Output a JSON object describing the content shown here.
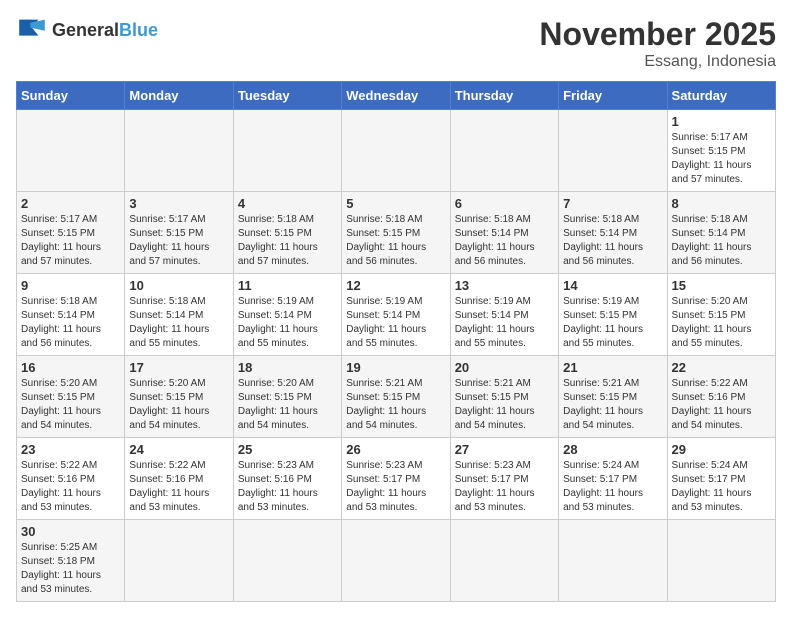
{
  "header": {
    "logo_general": "General",
    "logo_blue": "Blue",
    "month_year": "November 2025",
    "location": "Essang, Indonesia"
  },
  "weekdays": [
    "Sunday",
    "Monday",
    "Tuesday",
    "Wednesday",
    "Thursday",
    "Friday",
    "Saturday"
  ],
  "weeks": [
    [
      {
        "day": "",
        "info": ""
      },
      {
        "day": "",
        "info": ""
      },
      {
        "day": "",
        "info": ""
      },
      {
        "day": "",
        "info": ""
      },
      {
        "day": "",
        "info": ""
      },
      {
        "day": "",
        "info": ""
      },
      {
        "day": "1",
        "info": "Sunrise: 5:17 AM\nSunset: 5:15 PM\nDaylight: 11 hours\nand 57 minutes."
      }
    ],
    [
      {
        "day": "2",
        "info": "Sunrise: 5:17 AM\nSunset: 5:15 PM\nDaylight: 11 hours\nand 57 minutes."
      },
      {
        "day": "3",
        "info": "Sunrise: 5:17 AM\nSunset: 5:15 PM\nDaylight: 11 hours\nand 57 minutes."
      },
      {
        "day": "4",
        "info": "Sunrise: 5:18 AM\nSunset: 5:15 PM\nDaylight: 11 hours\nand 57 minutes."
      },
      {
        "day": "5",
        "info": "Sunrise: 5:18 AM\nSunset: 5:15 PM\nDaylight: 11 hours\nand 56 minutes."
      },
      {
        "day": "6",
        "info": "Sunrise: 5:18 AM\nSunset: 5:14 PM\nDaylight: 11 hours\nand 56 minutes."
      },
      {
        "day": "7",
        "info": "Sunrise: 5:18 AM\nSunset: 5:14 PM\nDaylight: 11 hours\nand 56 minutes."
      },
      {
        "day": "8",
        "info": "Sunrise: 5:18 AM\nSunset: 5:14 PM\nDaylight: 11 hours\nand 56 minutes."
      }
    ],
    [
      {
        "day": "9",
        "info": "Sunrise: 5:18 AM\nSunset: 5:14 PM\nDaylight: 11 hours\nand 56 minutes."
      },
      {
        "day": "10",
        "info": "Sunrise: 5:18 AM\nSunset: 5:14 PM\nDaylight: 11 hours\nand 55 minutes."
      },
      {
        "day": "11",
        "info": "Sunrise: 5:19 AM\nSunset: 5:14 PM\nDaylight: 11 hours\nand 55 minutes."
      },
      {
        "day": "12",
        "info": "Sunrise: 5:19 AM\nSunset: 5:14 PM\nDaylight: 11 hours\nand 55 minutes."
      },
      {
        "day": "13",
        "info": "Sunrise: 5:19 AM\nSunset: 5:14 PM\nDaylight: 11 hours\nand 55 minutes."
      },
      {
        "day": "14",
        "info": "Sunrise: 5:19 AM\nSunset: 5:15 PM\nDaylight: 11 hours\nand 55 minutes."
      },
      {
        "day": "15",
        "info": "Sunrise: 5:20 AM\nSunset: 5:15 PM\nDaylight: 11 hours\nand 55 minutes."
      }
    ],
    [
      {
        "day": "16",
        "info": "Sunrise: 5:20 AM\nSunset: 5:15 PM\nDaylight: 11 hours\nand 54 minutes."
      },
      {
        "day": "17",
        "info": "Sunrise: 5:20 AM\nSunset: 5:15 PM\nDaylight: 11 hours\nand 54 minutes."
      },
      {
        "day": "18",
        "info": "Sunrise: 5:20 AM\nSunset: 5:15 PM\nDaylight: 11 hours\nand 54 minutes."
      },
      {
        "day": "19",
        "info": "Sunrise: 5:21 AM\nSunset: 5:15 PM\nDaylight: 11 hours\nand 54 minutes."
      },
      {
        "day": "20",
        "info": "Sunrise: 5:21 AM\nSunset: 5:15 PM\nDaylight: 11 hours\nand 54 minutes."
      },
      {
        "day": "21",
        "info": "Sunrise: 5:21 AM\nSunset: 5:15 PM\nDaylight: 11 hours\nand 54 minutes."
      },
      {
        "day": "22",
        "info": "Sunrise: 5:22 AM\nSunset: 5:16 PM\nDaylight: 11 hours\nand 54 minutes."
      }
    ],
    [
      {
        "day": "23",
        "info": "Sunrise: 5:22 AM\nSunset: 5:16 PM\nDaylight: 11 hours\nand 53 minutes."
      },
      {
        "day": "24",
        "info": "Sunrise: 5:22 AM\nSunset: 5:16 PM\nDaylight: 11 hours\nand 53 minutes."
      },
      {
        "day": "25",
        "info": "Sunrise: 5:23 AM\nSunset: 5:16 PM\nDaylight: 11 hours\nand 53 minutes."
      },
      {
        "day": "26",
        "info": "Sunrise: 5:23 AM\nSunset: 5:17 PM\nDaylight: 11 hours\nand 53 minutes."
      },
      {
        "day": "27",
        "info": "Sunrise: 5:23 AM\nSunset: 5:17 PM\nDaylight: 11 hours\nand 53 minutes."
      },
      {
        "day": "28",
        "info": "Sunrise: 5:24 AM\nSunset: 5:17 PM\nDaylight: 11 hours\nand 53 minutes."
      },
      {
        "day": "29",
        "info": "Sunrise: 5:24 AM\nSunset: 5:17 PM\nDaylight: 11 hours\nand 53 minutes."
      }
    ],
    [
      {
        "day": "30",
        "info": "Sunrise: 5:25 AM\nSunset: 5:18 PM\nDaylight: 11 hours\nand 53 minutes."
      },
      {
        "day": "",
        "info": ""
      },
      {
        "day": "",
        "info": ""
      },
      {
        "day": "",
        "info": ""
      },
      {
        "day": "",
        "info": ""
      },
      {
        "day": "",
        "info": ""
      },
      {
        "day": "",
        "info": ""
      }
    ]
  ]
}
